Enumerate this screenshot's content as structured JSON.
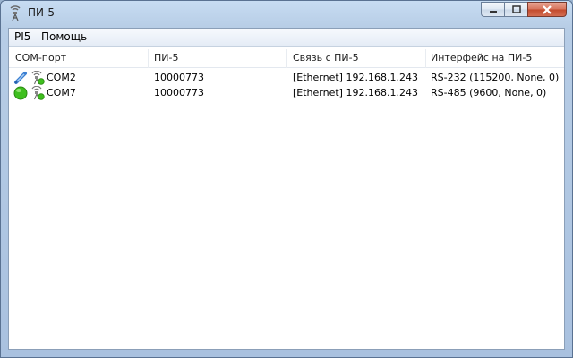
{
  "window": {
    "title": "ПИ-5",
    "title_icon": "antenna-icon"
  },
  "menu": {
    "items": [
      "PI5",
      "Помощь"
    ]
  },
  "table": {
    "columns": [
      "COM-порт",
      "ПИ-5",
      "Связь с ПИ-5",
      "Интерфейс на ПИ-5"
    ],
    "rows": [
      {
        "status_icon": "plug-connector-icon",
        "device_icon": "antenna-status-icon",
        "port": "COM2",
        "pi5": "10000773",
        "link": "[Ethernet] 192.168.1.243",
        "iface": "RS-232 (115200, None, 0)"
      },
      {
        "status_icon": "green-circle-icon",
        "device_icon": "antenna-status-icon",
        "port": "COM7",
        "pi5": "10000773",
        "link": "[Ethernet] 192.168.1.243",
        "iface": "RS-485 (9600, None, 0)"
      }
    ]
  },
  "colors": {
    "status_ok": "#3fbf1f",
    "plug": "#3b7fd1"
  }
}
